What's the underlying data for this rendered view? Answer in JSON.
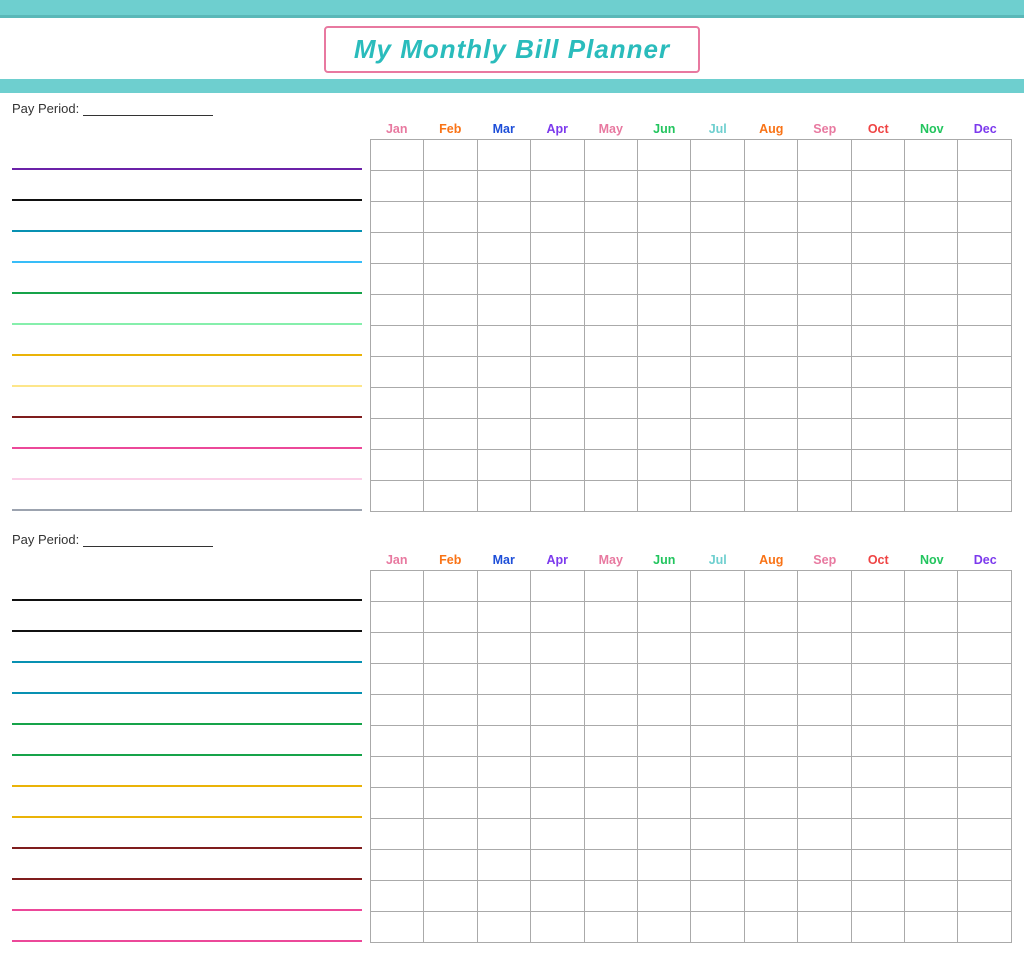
{
  "header": {
    "title": "My Monthly Bill Planner",
    "title_color": "#2abcbc",
    "border_color": "#e879a0"
  },
  "months": [
    {
      "label": "Jan",
      "class": "m-jan"
    },
    {
      "label": "Feb",
      "class": "m-feb"
    },
    {
      "label": "Mar",
      "class": "m-mar"
    },
    {
      "label": "Apr",
      "class": "m-apr"
    },
    {
      "label": "May",
      "class": "m-may"
    },
    {
      "label": "Jun",
      "class": "m-jun"
    },
    {
      "label": "Jul",
      "class": "m-jul"
    },
    {
      "label": "Aug",
      "class": "m-aug"
    },
    {
      "label": "Sep",
      "class": "m-sep"
    },
    {
      "label": "Oct",
      "class": "m-oct"
    },
    {
      "label": "Nov",
      "class": "m-nov"
    },
    {
      "label": "Dec",
      "class": "m-dec"
    }
  ],
  "section1": {
    "pay_period_label": "Pay Period:",
    "rows": 12,
    "line_colors": [
      "line-purple",
      "line-black",
      "line-teal",
      "line-ltblue",
      "line-green",
      "line-ltgreen",
      "line-yellow",
      "line-ltyellow",
      "line-darkred",
      "line-pink",
      "line-ltpink",
      "line-gray"
    ]
  },
  "section2": {
    "pay_period_label": "Pay Period:",
    "rows": 12,
    "line_colors": [
      "line-black",
      "line-black",
      "line-teal",
      "line-teal",
      "line-green",
      "line-green",
      "line-yellow",
      "line-yellow",
      "line-darkred",
      "line-darkred",
      "line-pink",
      "line-pink"
    ]
  }
}
